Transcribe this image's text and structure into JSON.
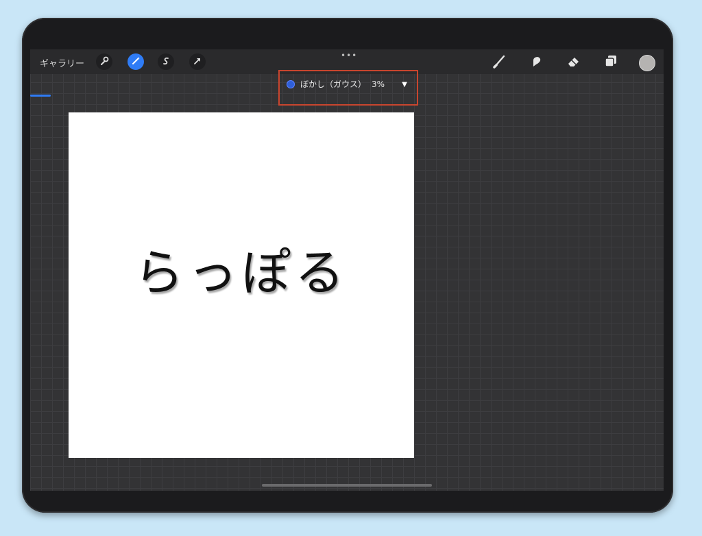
{
  "toolbar": {
    "gallery_label": "ギャラリー",
    "grabber": "•••",
    "active_tool": "adjustments"
  },
  "adjustment": {
    "label": "ぼかし（ガウス）",
    "value": "3%",
    "dropdown_arrow": "▼"
  },
  "canvas": {
    "text": "らっぽる"
  },
  "colors": {
    "accent": "#2f7cf6",
    "highlight_border": "#c9452e",
    "canvas_bg": "#ffffff",
    "current_color": "#b5b3b1"
  },
  "icons": {
    "left": [
      "wrench-icon",
      "magic-wand-icon",
      "selection-icon",
      "transform-arrow-icon"
    ],
    "right": [
      "brush-icon",
      "smudge-icon",
      "eraser-icon",
      "layers-icon",
      "color-swatch"
    ]
  }
}
